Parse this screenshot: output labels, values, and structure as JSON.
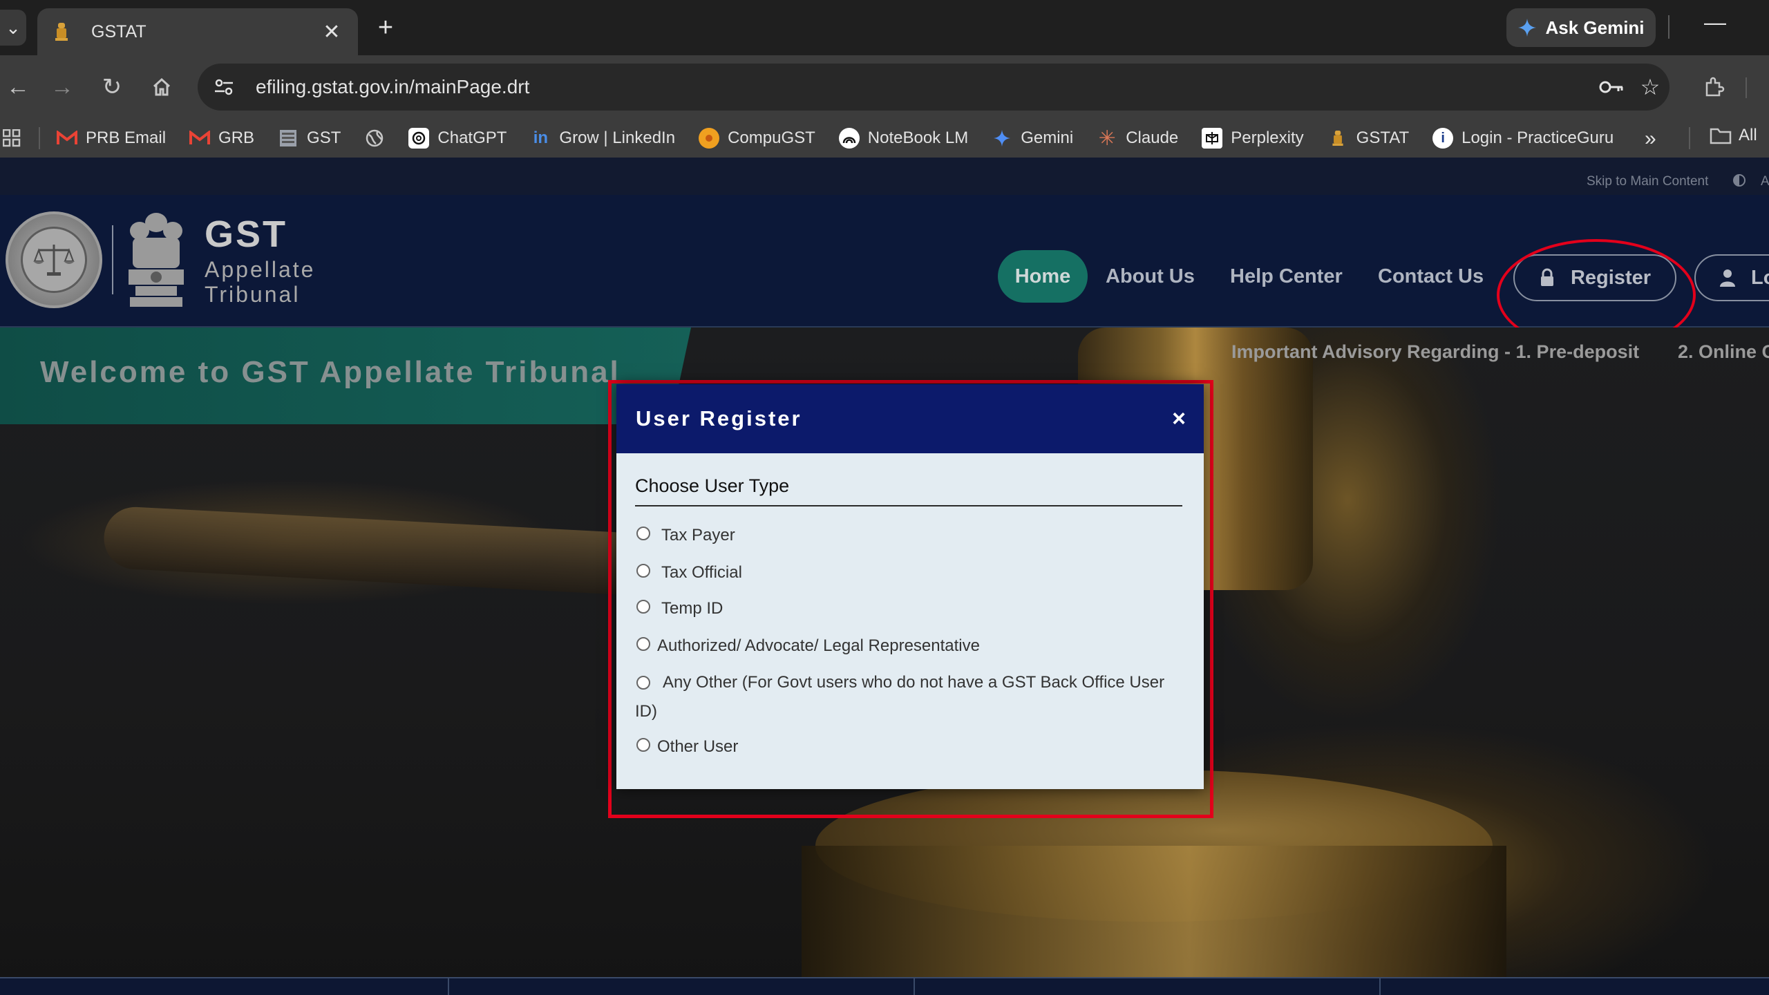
{
  "browser": {
    "tab_title": "GSTAT",
    "url": "efiling.gstat.gov.in/mainPage.drt",
    "ask_gemini": "Ask Gemini",
    "bookmarks": [
      {
        "label": "PRB Email",
        "icon": "gmail-icon"
      },
      {
        "label": "GRB",
        "icon": "gmail-icon"
      },
      {
        "label": "GST",
        "icon": "gst-icon"
      },
      {
        "label": "",
        "icon": "globe-icon"
      },
      {
        "label": "ChatGPT",
        "icon": "chatgpt-icon"
      },
      {
        "label": "Grow | LinkedIn",
        "icon": "linkedin-icon"
      },
      {
        "label": "CompuGST",
        "icon": "compugst-icon"
      },
      {
        "label": "NoteBook LM",
        "icon": "notebooklm-icon"
      },
      {
        "label": "Gemini",
        "icon": "gemini-icon"
      },
      {
        "label": "Claude",
        "icon": "claude-icon"
      },
      {
        "label": "Perplexity",
        "icon": "perplexity-icon"
      },
      {
        "label": "GSTAT",
        "icon": "emblem-icon"
      },
      {
        "label": "Login - PracticeGuru",
        "icon": "info-icon"
      }
    ],
    "all_bookmarks": "All"
  },
  "page": {
    "skip_link": "Skip to Main Content",
    "a_label": "A",
    "brand": {
      "line1": "GST",
      "line2": "Appellate",
      "line3": "Tribunal"
    },
    "nav": {
      "home": "Home",
      "about": "About Us",
      "help": "Help Center",
      "contact": "Contact Us",
      "register": "Register",
      "login": "Lo"
    },
    "welcome": "Welcome to GST Appellate Tribunal",
    "ticker": "Important Advisory Regarding - 1. Pre-deposit",
    "ticker2": "2. Online C"
  },
  "modal": {
    "title": "User Register",
    "close": "×",
    "section_title": "Choose User Type",
    "options": [
      "Tax Payer",
      "Tax Official",
      "Temp ID",
      "Authorized/ Advocate/ Legal Representative",
      "Any Other (For Govt users who do not have a GST Back Office User ID)",
      "Other User"
    ]
  },
  "colors": {
    "modal_header": "#0c1a6b",
    "home_pill": "#157063",
    "highlight_red": "#e3001b",
    "chrome_bg": "#3c3c3c"
  }
}
